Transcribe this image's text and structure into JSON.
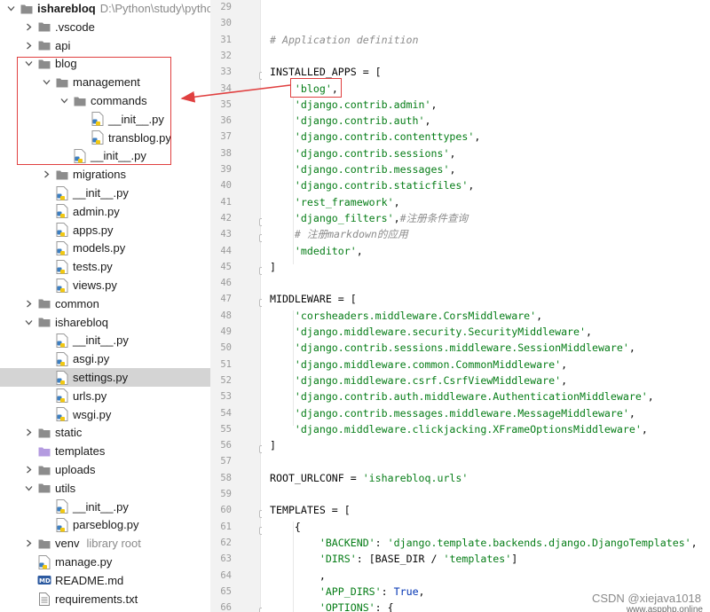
{
  "project_tree": {
    "rows": [
      {
        "label": "isharebloq",
        "path": "D:\\Python\\study\\pytho",
        "icon": "folder-icon",
        "depth": 0,
        "chevron": "down",
        "bold": true
      },
      {
        "label": ".vscode",
        "icon": "folder-icon",
        "depth": 1,
        "chevron": "right"
      },
      {
        "label": "api",
        "icon": "folder-icon",
        "depth": 1,
        "chevron": "right"
      },
      {
        "label": "blog",
        "icon": "folder-icon",
        "depth": 1,
        "chevron": "down"
      },
      {
        "label": "management",
        "icon": "folder-icon",
        "depth": 2,
        "chevron": "down"
      },
      {
        "label": "commands",
        "icon": "folder-icon",
        "depth": 3,
        "chevron": "down"
      },
      {
        "label": "__init__.py",
        "icon": "python-file-icon",
        "depth": 4,
        "chevron": ""
      },
      {
        "label": "transblog.py",
        "icon": "python-file-icon",
        "depth": 4,
        "chevron": ""
      },
      {
        "label": "__init__.py",
        "icon": "python-file-icon",
        "depth": 3,
        "chevron": ""
      },
      {
        "label": "migrations",
        "icon": "folder-icon",
        "depth": 2,
        "chevron": "right"
      },
      {
        "label": "__init__.py",
        "icon": "python-file-icon",
        "depth": 2,
        "chevron": ""
      },
      {
        "label": "admin.py",
        "icon": "python-file-icon",
        "depth": 2,
        "chevron": ""
      },
      {
        "label": "apps.py",
        "icon": "python-file-icon",
        "depth": 2,
        "chevron": ""
      },
      {
        "label": "models.py",
        "icon": "python-file-icon",
        "depth": 2,
        "chevron": ""
      },
      {
        "label": "tests.py",
        "icon": "python-file-icon",
        "depth": 2,
        "chevron": ""
      },
      {
        "label": "views.py",
        "icon": "python-file-icon",
        "depth": 2,
        "chevron": ""
      },
      {
        "label": "common",
        "icon": "folder-icon",
        "depth": 1,
        "chevron": "right"
      },
      {
        "label": "isharebloq",
        "icon": "folder-icon",
        "depth": 1,
        "chevron": "down"
      },
      {
        "label": "__init__.py",
        "icon": "python-file-icon",
        "depth": 2,
        "chevron": ""
      },
      {
        "label": "asgi.py",
        "icon": "python-file-icon",
        "depth": 2,
        "chevron": ""
      },
      {
        "label": "settings.py",
        "icon": "python-file-icon",
        "depth": 2,
        "chevron": "",
        "selected": true
      },
      {
        "label": "urls.py",
        "icon": "python-file-icon",
        "depth": 2,
        "chevron": ""
      },
      {
        "label": "wsgi.py",
        "icon": "python-file-icon",
        "depth": 2,
        "chevron": ""
      },
      {
        "label": "static",
        "icon": "folder-icon",
        "depth": 1,
        "chevron": "right"
      },
      {
        "label": "templates",
        "icon": "templates-folder-icon",
        "depth": 1,
        "chevron": ""
      },
      {
        "label": "uploads",
        "icon": "folder-icon",
        "depth": 1,
        "chevron": "right"
      },
      {
        "label": "utils",
        "icon": "folder-icon",
        "depth": 1,
        "chevron": "down"
      },
      {
        "label": "__init__.py",
        "icon": "python-file-icon",
        "depth": 2,
        "chevron": ""
      },
      {
        "label": "parseblog.py",
        "icon": "python-file-icon",
        "depth": 2,
        "chevron": ""
      },
      {
        "label": "venv",
        "note": "library root",
        "icon": "folder-icon",
        "depth": 1,
        "chevron": "right"
      },
      {
        "label": "manage.py",
        "icon": "python-file-icon",
        "depth": 1,
        "chevron": ""
      },
      {
        "label": "README.md",
        "icon": "markdown-file-icon",
        "depth": 1,
        "chevron": ""
      },
      {
        "label": "requirements.txt",
        "icon": "text-file-icon",
        "depth": 1,
        "chevron": ""
      }
    ]
  },
  "editor": {
    "lines": [
      {
        "n": "29",
        "parts": []
      },
      {
        "n": "30",
        "parts": []
      },
      {
        "n": "31",
        "parts": [
          {
            "t": "# Application definition",
            "c": "cm"
          }
        ]
      },
      {
        "n": "32",
        "parts": []
      },
      {
        "n": "33",
        "parts": [
          {
            "t": "INSTALLED_APPS = [",
            "c": "kw"
          }
        ],
        "fold": true
      },
      {
        "n": "34",
        "parts": [
          {
            "t": "    "
          },
          {
            "t": "'blog'",
            "c": "str"
          },
          {
            "t": ","
          }
        ]
      },
      {
        "n": "35",
        "parts": [
          {
            "t": "    "
          },
          {
            "t": "'django.contrib.admin'",
            "c": "str"
          },
          {
            "t": ","
          }
        ]
      },
      {
        "n": "36",
        "parts": [
          {
            "t": "    "
          },
          {
            "t": "'django.contrib.auth'",
            "c": "str"
          },
          {
            "t": ","
          }
        ]
      },
      {
        "n": "37",
        "parts": [
          {
            "t": "    "
          },
          {
            "t": "'django.contrib.contenttypes'",
            "c": "str"
          },
          {
            "t": ","
          }
        ]
      },
      {
        "n": "38",
        "parts": [
          {
            "t": "    "
          },
          {
            "t": "'django.contrib.sessions'",
            "c": "str"
          },
          {
            "t": ","
          }
        ]
      },
      {
        "n": "39",
        "parts": [
          {
            "t": "    "
          },
          {
            "t": "'django.contrib.messages'",
            "c": "str"
          },
          {
            "t": ","
          }
        ]
      },
      {
        "n": "40",
        "parts": [
          {
            "t": "    "
          },
          {
            "t": "'django.contrib.staticfiles'",
            "c": "str"
          },
          {
            "t": ","
          }
        ]
      },
      {
        "n": "41",
        "parts": [
          {
            "t": "    "
          },
          {
            "t": "'rest_framework'",
            "c": "str"
          },
          {
            "t": ","
          }
        ]
      },
      {
        "n": "42",
        "parts": [
          {
            "t": "    "
          },
          {
            "t": "'django_filters'",
            "c": "str"
          },
          {
            "t": ","
          },
          {
            "t": "#注册条件查询",
            "c": "cm"
          }
        ],
        "fold": true
      },
      {
        "n": "43",
        "parts": [
          {
            "t": "    "
          },
          {
            "t": "# 注册markdown的应用",
            "c": "cm"
          }
        ],
        "fold": true
      },
      {
        "n": "44",
        "parts": [
          {
            "t": "    "
          },
          {
            "t": "'mdeditor'",
            "c": "str"
          },
          {
            "t": ","
          }
        ]
      },
      {
        "n": "45",
        "parts": [
          {
            "t": "]"
          }
        ],
        "fold": true
      },
      {
        "n": "46",
        "parts": []
      },
      {
        "n": "47",
        "parts": [
          {
            "t": "MIDDLEWARE = ["
          }
        ],
        "fold": true
      },
      {
        "n": "48",
        "parts": [
          {
            "t": "    "
          },
          {
            "t": "'corsheaders.middleware.CorsMiddleware'",
            "c": "str"
          },
          {
            "t": ","
          }
        ]
      },
      {
        "n": "49",
        "parts": [
          {
            "t": "    "
          },
          {
            "t": "'django.middleware.security.SecurityMiddleware'",
            "c": "str"
          },
          {
            "t": ","
          }
        ]
      },
      {
        "n": "50",
        "parts": [
          {
            "t": "    "
          },
          {
            "t": "'django.contrib.sessions.middleware.SessionMiddleware'",
            "c": "str"
          },
          {
            "t": ","
          }
        ]
      },
      {
        "n": "51",
        "parts": [
          {
            "t": "    "
          },
          {
            "t": "'django.middleware.common.CommonMiddleware'",
            "c": "str"
          },
          {
            "t": ","
          }
        ]
      },
      {
        "n": "52",
        "parts": [
          {
            "t": "    "
          },
          {
            "t": "'django.middleware.csrf.CsrfViewMiddleware'",
            "c": "str"
          },
          {
            "t": ","
          }
        ]
      },
      {
        "n": "53",
        "parts": [
          {
            "t": "    "
          },
          {
            "t": "'django.contrib.auth.middleware.AuthenticationMiddleware'",
            "c": "str"
          },
          {
            "t": ","
          }
        ]
      },
      {
        "n": "54",
        "parts": [
          {
            "t": "    "
          },
          {
            "t": "'django.contrib.messages.middleware.MessageMiddleware'",
            "c": "str"
          },
          {
            "t": ","
          }
        ]
      },
      {
        "n": "55",
        "parts": [
          {
            "t": "    "
          },
          {
            "t": "'django.middleware.clickjacking.XFrameOptionsMiddleware'",
            "c": "str"
          },
          {
            "t": ","
          }
        ]
      },
      {
        "n": "56",
        "parts": [
          {
            "t": "]"
          }
        ],
        "fold": true
      },
      {
        "n": "57",
        "parts": []
      },
      {
        "n": "58",
        "parts": [
          {
            "t": "ROOT_URLCONF = "
          },
          {
            "t": "'isharebloq.urls'",
            "c": "str"
          }
        ]
      },
      {
        "n": "59",
        "parts": []
      },
      {
        "n": "60",
        "parts": [
          {
            "t": "TEMPLATES = ["
          }
        ],
        "fold": true
      },
      {
        "n": "61",
        "parts": [
          {
            "t": "    {"
          }
        ],
        "fold": true
      },
      {
        "n": "62",
        "parts": [
          {
            "t": "        "
          },
          {
            "t": "'BACKEND'",
            "c": "str"
          },
          {
            "t": ": "
          },
          {
            "t": "'django.template.backends.django.DjangoTemplates'",
            "c": "str"
          },
          {
            "t": ","
          }
        ]
      },
      {
        "n": "63",
        "parts": [
          {
            "t": "        "
          },
          {
            "t": "'DIRS'",
            "c": "str"
          },
          {
            "t": ": [BASE_DIR / "
          },
          {
            "t": "'templates'",
            "c": "str"
          },
          {
            "t": "]"
          }
        ]
      },
      {
        "n": "64",
        "parts": [
          {
            "t": "        ,"
          }
        ]
      },
      {
        "n": "65",
        "parts": [
          {
            "t": "        "
          },
          {
            "t": "'APP_DIRS'",
            "c": "str"
          },
          {
            "t": ": "
          },
          {
            "t": "True",
            "c": "kwb"
          },
          {
            "t": ","
          }
        ]
      },
      {
        "n": "66",
        "parts": [
          {
            "t": "        "
          },
          {
            "t": "'OPTIONS'",
            "c": "str"
          },
          {
            "t": ": {"
          }
        ],
        "fold": true
      }
    ]
  },
  "watermark": {
    "text": "CSDN @xiejava1018",
    "site": "www.aspphp.online"
  },
  "colors": {
    "annotation": "#e04040",
    "string": "#067d17",
    "comment": "#8c8c8c",
    "keyword": "#0033b3",
    "selection": "#d4d4d4"
  }
}
